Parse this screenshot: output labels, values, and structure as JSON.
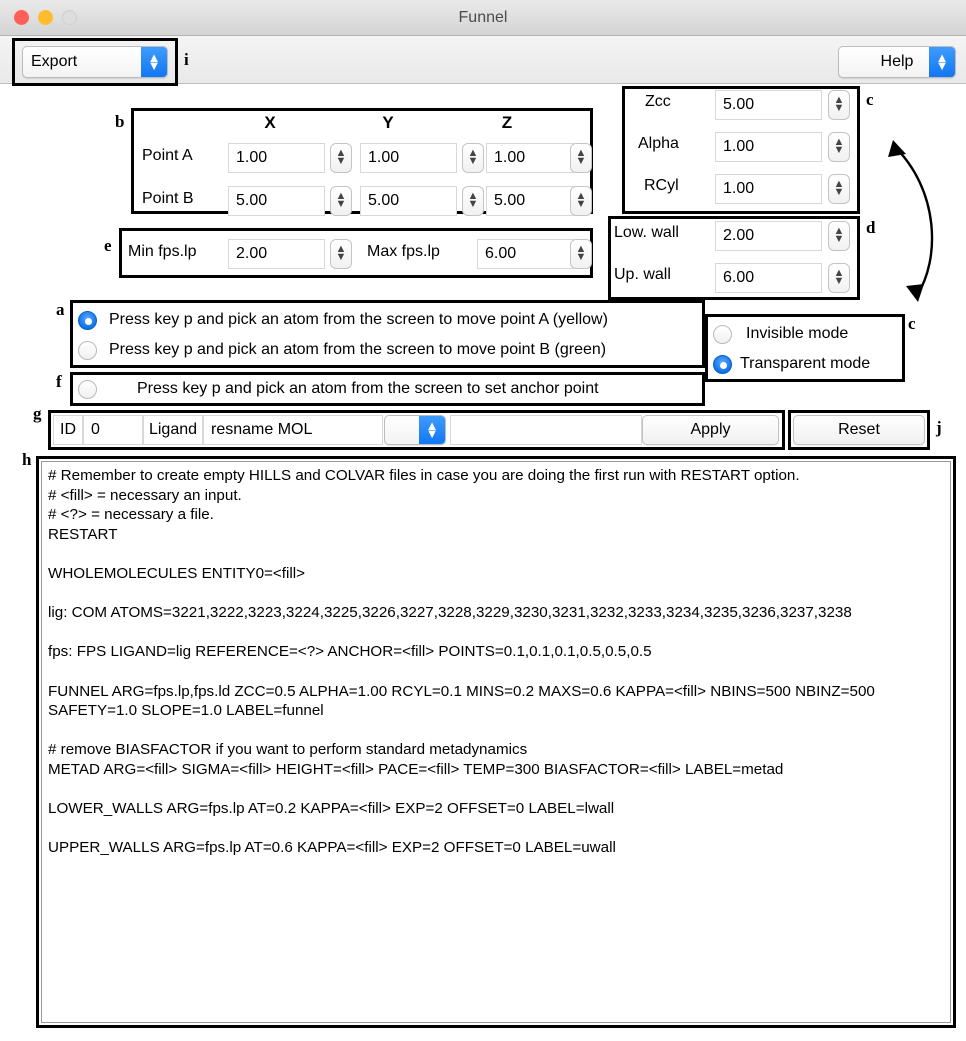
{
  "window": {
    "title": "Funnel",
    "traffic_lights": [
      "close-red",
      "minimize-yellow",
      "zoom-gray"
    ]
  },
  "toolbar": {
    "export_label": "Export",
    "help_label": "Help",
    "stepper_icon": "up-down-chevrons"
  },
  "annotations": {
    "a": "a",
    "b": "b",
    "c_top": "c",
    "c_bottom": "c",
    "d": "d",
    "e": "e",
    "f": "f",
    "g": "g",
    "h": "h",
    "i": "i",
    "j": "j"
  },
  "points_panel": {
    "headers": [
      "X",
      "Y",
      "Z"
    ],
    "rows": [
      {
        "label": "Point A",
        "x": "1.00",
        "y": "1.00",
        "z": "1.00"
      },
      {
        "label": "Point B",
        "x": "5.00",
        "y": "5.00",
        "z": "5.00"
      }
    ]
  },
  "funnel_params": {
    "rows": [
      {
        "label": "Zcc",
        "value": "5.00"
      },
      {
        "label": "Alpha",
        "value": "1.00"
      },
      {
        "label": "RCyl",
        "value": "1.00"
      }
    ]
  },
  "walls": {
    "rows": [
      {
        "label": "Low. wall",
        "value": "2.00"
      },
      {
        "label": "Up. wall",
        "value": "6.00"
      }
    ]
  },
  "fps_range": {
    "min_label": "Min fps.lp",
    "min_value": "2.00",
    "max_label": "Max fps.lp",
    "max_value": "6.00"
  },
  "pick_options": {
    "items": [
      {
        "label": "Press key p and pick an atom from the screen to move point A (yellow)",
        "selected": true
      },
      {
        "label": "Press key p and pick an atom from the screen to move point B (green)",
        "selected": false
      }
    ],
    "anchor": {
      "label": "Press key p and pick an atom from the screen to set anchor point",
      "selected": false
    }
  },
  "view_modes": {
    "items": [
      {
        "label": "Invisible mode",
        "selected": false
      },
      {
        "label": "Transparent mode",
        "selected": true
      }
    ]
  },
  "ligand_row": {
    "id_label": "ID",
    "id_value": "0",
    "ligand_label": "Ligand",
    "selection_value": "resname MOL",
    "dropdown_value": "",
    "extra_value": "",
    "apply_label": "Apply",
    "reset_label": "Reset"
  },
  "script": {
    "lines": [
      "# Remember to create empty HILLS and COLVAR files in case you are doing the first run with RESTART option.",
      "# <fill> = necessary an input.",
      "# <?> = necessary a file.",
      "RESTART",
      "",
      "WHOLEMOLECULES ENTITY0=<fill>",
      "",
      "lig: COM ATOMS=3221,3222,3223,3224,3225,3226,3227,3228,3229,3230,3231,3232,3233,3234,3235,3236,3237,3238",
      "",
      "fps: FPS LIGAND=lig REFERENCE=<?> ANCHOR=<fill> POINTS=0.1,0.1,0.1,0.5,0.5,0.5",
      "",
      "FUNNEL ARG=fps.lp,fps.ld ZCC=0.5 ALPHA=1.00 RCYL=0.1 MINS=0.2 MAXS=0.6 KAPPA=<fill> NBINS=500 NBINZ=500 SAFETY=1.0 SLOPE=1.0 LABEL=funnel",
      "",
      "# remove BIASFACTOR if you want to perform standard metadynamics",
      "METAD ARG=<fill> SIGMA=<fill> HEIGHT=<fill> PACE=<fill> TEMP=300 BIASFACTOR=<fill> LABEL=metad",
      "",
      "LOWER_WALLS ARG=fps.lp AT=0.2 KAPPA=<fill> EXP=2 OFFSET=0 LABEL=lwall",
      "",
      "UPPER_WALLS ARG=fps.lp AT=0.6 KAPPA=<fill> EXP=2 OFFSET=0 LABEL=uwall"
    ]
  },
  "colors": {
    "accent_blue": "#1177f2",
    "close_red": "#ff5f57",
    "minimize_yellow": "#ffbd2e",
    "zoom_gray": "#dddddd"
  }
}
